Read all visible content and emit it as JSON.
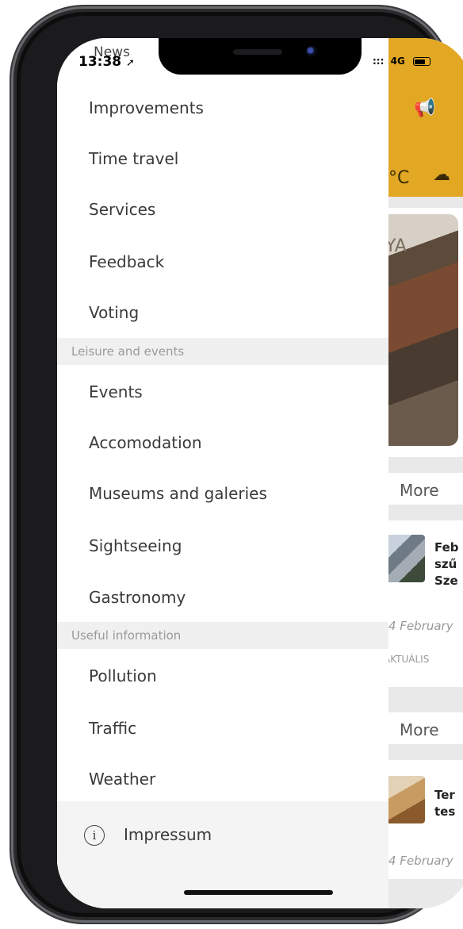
{
  "status_bar": {
    "time": "13:38",
    "carrier_overlay": "News",
    "signal": ":::",
    "network": "4G"
  },
  "drawer": {
    "items_top": [
      "Improvements",
      "Time travel",
      "Services",
      "Feedback",
      "Voting"
    ],
    "section_leisure": "Leisure and events",
    "items_leisure": [
      "Events",
      "Accomodation",
      "Museums and galeries",
      "Sightseeing",
      "Gastronomy"
    ],
    "section_useful": "Useful information",
    "items_useful": [
      "Pollution",
      "Traffic",
      "Weather"
    ],
    "footer": {
      "label": "Impressum",
      "icon": "info-icon"
    }
  },
  "background": {
    "temperature": "°C",
    "card_text": "YA",
    "more_1": "More",
    "news_1": {
      "title_lines": [
        "Feb",
        "szű",
        "Sze"
      ],
      "date": "4 February",
      "category": "AKTUÁLIS"
    },
    "more_2": "More",
    "news_2": {
      "title_lines": [
        "Ter",
        "tes"
      ],
      "date": "4 February"
    }
  },
  "colors": {
    "accent": "#e2a823",
    "drawer_bg": "#ffffff",
    "section_bg": "#f0f0f0"
  }
}
